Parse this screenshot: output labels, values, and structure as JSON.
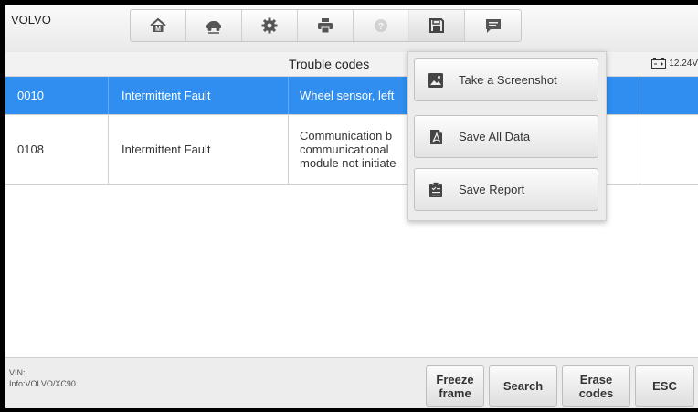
{
  "app": {
    "brand": "VOLVO"
  },
  "toolbar": {
    "items": [
      {
        "icon": "home-icon"
      },
      {
        "icon": "vehicle-swap-icon"
      },
      {
        "icon": "settings-icon"
      },
      {
        "icon": "print-icon"
      },
      {
        "icon": "help-icon"
      },
      {
        "icon": "save-icon"
      },
      {
        "icon": "message-icon"
      }
    ]
  },
  "header": {
    "title": "Trouble codes",
    "battery": "12.24V"
  },
  "table": {
    "rows": [
      {
        "code": "0010",
        "status": "Intermittent Fault",
        "description": "Wheel sensor, left",
        "selected": true
      },
      {
        "code": "0108",
        "status": "Intermittent Fault",
        "description_lines": [
          "Communication b",
          "communicational",
          "module not initiate"
        ],
        "selected": false
      }
    ]
  },
  "footer": {
    "vin_label": "VIN:",
    "info": "Info:VOLVO/XC90",
    "buttons": {
      "freeze_frame_line1": "Freeze",
      "freeze_frame_line2": "frame",
      "search": "Search",
      "erase_line1": "Erase",
      "erase_line2": "codes",
      "esc": "ESC"
    }
  },
  "save_menu": {
    "items": [
      {
        "label": "Take a Screenshot",
        "icon": "image-icon"
      },
      {
        "label": "Save All Data",
        "icon": "pdf-document-icon"
      },
      {
        "label": "Save Report",
        "icon": "clipboard-report-icon"
      }
    ]
  },
  "colors": {
    "selected_row": "#2f8ef0",
    "background": "#ffffff"
  }
}
